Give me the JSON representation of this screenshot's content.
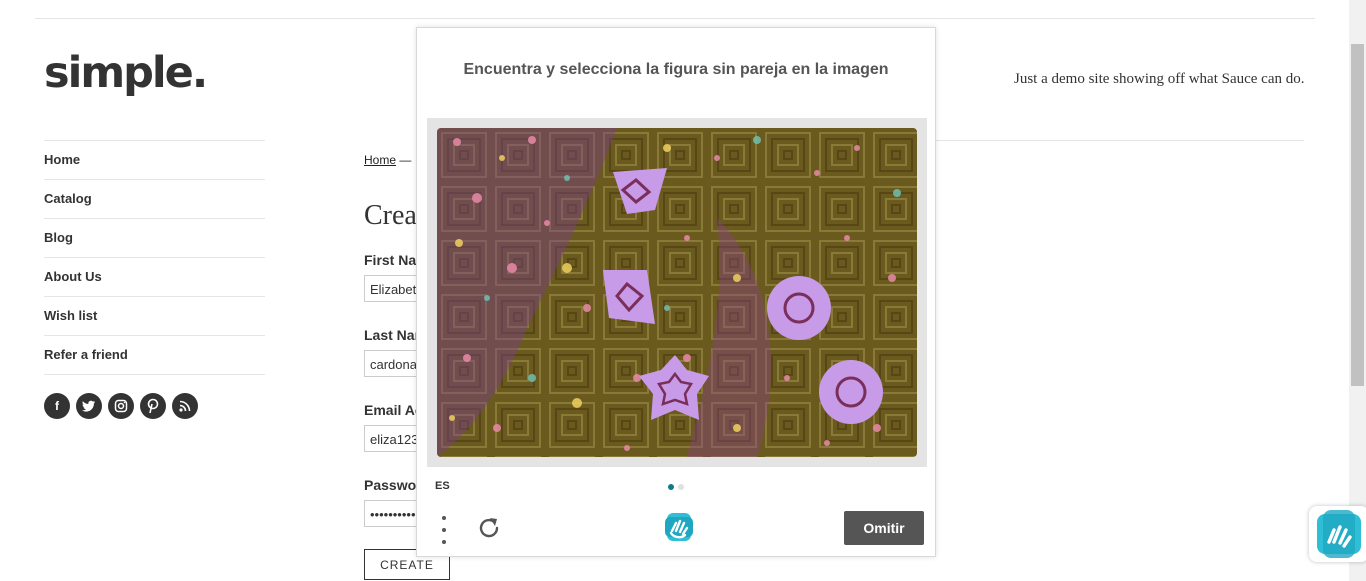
{
  "site": {
    "logo": "simple.",
    "tagline": "Just a demo site showing off what Sauce can do."
  },
  "sidebar": {
    "items": [
      {
        "label": "Home"
      },
      {
        "label": "Catalog"
      },
      {
        "label": "Blog"
      },
      {
        "label": "About Us"
      },
      {
        "label": "Wish list"
      },
      {
        "label": "Refer a friend"
      }
    ],
    "social_icons": [
      "facebook-icon",
      "twitter-icon",
      "instagram-icon",
      "pinterest-icon",
      "rss-icon"
    ]
  },
  "main": {
    "breadcrumb_home": "Home",
    "breadcrumb_sep": "—",
    "title": "Crea",
    "first_name_label": "First Nar",
    "first_name_value": "Elizabet",
    "last_name_label": "Last Nar",
    "last_name_value": "cardona",
    "email_label": "Email Ac",
    "email_value": "eliza123",
    "password_label": "Passwor",
    "password_value": "•••••••••••",
    "create_label": "CREATE"
  },
  "captcha": {
    "prompt": "Encuentra y selecciona la figura sin pareja en la imagen",
    "language": "ES",
    "skip_label": "Omitir",
    "page_dots": [
      {
        "active": true
      },
      {
        "active": false
      }
    ],
    "colors": {
      "accent": "#0f7b8a",
      "skip_button": "#555555",
      "shape_fill": "#c79be8",
      "background_olive": "#6f5c20",
      "background_purple": "#7a4a6f"
    },
    "shapes": [
      "diamond",
      "diamond",
      "circle",
      "circle",
      "star"
    ]
  }
}
